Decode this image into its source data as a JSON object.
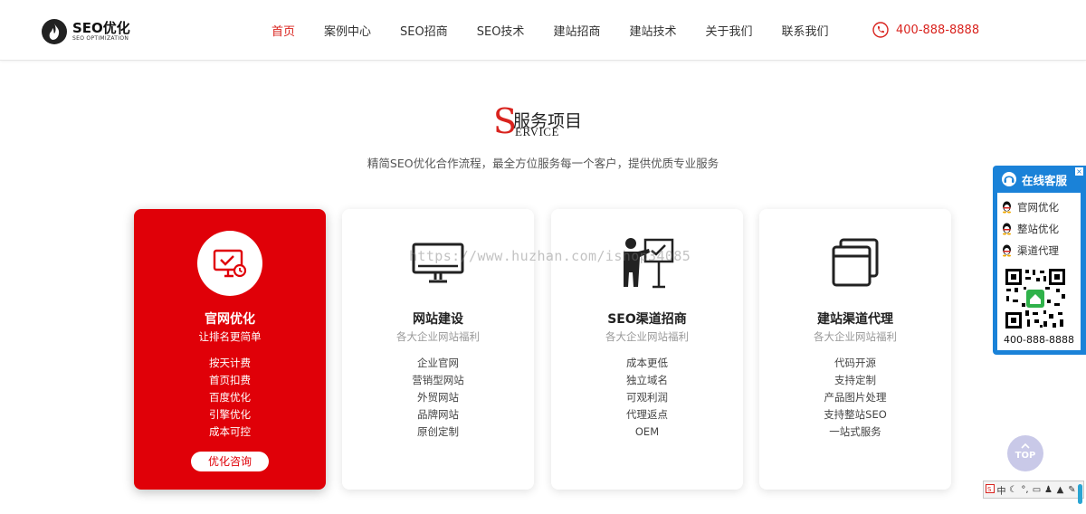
{
  "header": {
    "logo_title": "SEO优化",
    "logo_sub": "SEO OPTIMIZATION",
    "nav": [
      {
        "label": "首页",
        "active": true
      },
      {
        "label": "案例中心"
      },
      {
        "label": "SEO招商"
      },
      {
        "label": "SEO技术"
      },
      {
        "label": "建站招商"
      },
      {
        "label": "建站技术"
      },
      {
        "label": "关于我们"
      },
      {
        "label": "联系我们"
      }
    ],
    "phone": "400-888-8888"
  },
  "section": {
    "title_s": "S",
    "title_cn": "服务项目",
    "title_en": "ERVICE",
    "subtitle": "精简SEO优化合作流程，最全方位服务每一个客户，提供优质专业服务"
  },
  "cards": [
    {
      "name": "官网优化",
      "tagline": "让排名更简单",
      "icon": "monitor-check-icon",
      "features": [
        "按天计费",
        "首页扣费",
        "百度优化",
        "引擎优化",
        "成本可控"
      ],
      "button": "优化咨询"
    },
    {
      "name": "网站建设",
      "tagline": "各大企业网站福利",
      "icon": "desktop-monitor-icon",
      "features": [
        "企业官网",
        "营销型网站",
        "外贸网站",
        "品牌网站",
        "原创定制"
      ]
    },
    {
      "name": "SEO渠道招商",
      "tagline": "各大企业网站福利",
      "icon": "presenter-board-icon",
      "features": [
        "成本更低",
        "独立域名",
        "可观利润",
        "代理返点",
        "OEM"
      ]
    },
    {
      "name": "建站渠道代理",
      "tagline": "各大企业网站福利",
      "icon": "browser-windows-icon",
      "features": [
        "代码开源",
        "支持定制",
        "产品图片处理",
        "支持整站SEO",
        "一站式服务"
      ]
    }
  ],
  "watermark": "https://www.huzhan.com/ishop34085",
  "online_service": {
    "title": "在线客服",
    "close": "×",
    "items": [
      "官网优化",
      "整站优化",
      "渠道代理"
    ],
    "phone": "400-888-8888"
  },
  "top_button": "TOP",
  "ime": [
    "中",
    "·",
    "·",
    "··",
    "·",
    "·",
    "·"
  ],
  "colors": {
    "brand_red": "#d9231e",
    "card_active": "#e00008",
    "service_blue": "#1a82d8"
  }
}
